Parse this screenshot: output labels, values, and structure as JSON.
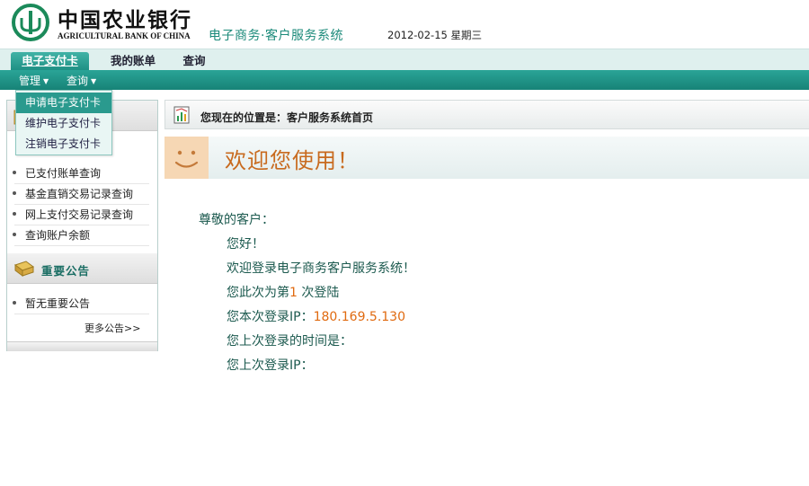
{
  "header": {
    "bank_name_cn": "中国农业银行",
    "bank_name_en": "AGRICULTURAL BANK OF CHINA",
    "system_title": "电子商务·客户服务系统",
    "date": "2012-02-15 星期三"
  },
  "nav": {
    "tabs": [
      {
        "label": "电子支付卡",
        "active": true
      },
      {
        "label": "我的账单",
        "active": false
      },
      {
        "label": "查询",
        "active": false
      }
    ],
    "submenu": [
      {
        "label": "管理",
        "icon": "chevron-down-icon"
      },
      {
        "label": "查询",
        "icon": "chevron-down-icon"
      }
    ],
    "dropdown": [
      {
        "label": "申请电子支付卡",
        "highlighted": true
      },
      {
        "label": "维护电子支付卡",
        "highlighted": false
      },
      {
        "label": "注销电子支付卡",
        "highlighted": false
      }
    ]
  },
  "sidebar": {
    "section1": {
      "icon": "folder-icon",
      "links": [
        "已支付账单查询",
        "基金直销交易记录查询",
        "网上支付交易记录查询",
        "查询账户余额"
      ]
    },
    "section2": {
      "title": "重要公告",
      "icon": "notice-icon",
      "items": [
        "暂无重要公告"
      ],
      "more_label": "更多公告>>"
    }
  },
  "breadcrumb": {
    "icon": "chart-page-icon",
    "text": "您现在的位置是：客户服务系统首页"
  },
  "welcome": {
    "icon": "smiley-icon",
    "title": "欢迎您使用！"
  },
  "message": {
    "salutation": "尊敬的客户：",
    "hello": "您好！",
    "welcome_line": "欢迎登录电子商务客户服务系统！",
    "login_count_prefix": "您此次为第",
    "login_count": "1",
    "login_count_suffix": "次登陆",
    "ip_label": "您本次登录IP：",
    "ip_value": "180.169.5.130",
    "last_time_label": "您上次登录的时间是：",
    "last_ip_label": "您上次登录IP："
  },
  "colors": {
    "brand_green": "#1b8a7a",
    "nav_teal": "#2aa497",
    "accent_orange": "#e06a10",
    "welcome_orange": "#c86a1e"
  }
}
